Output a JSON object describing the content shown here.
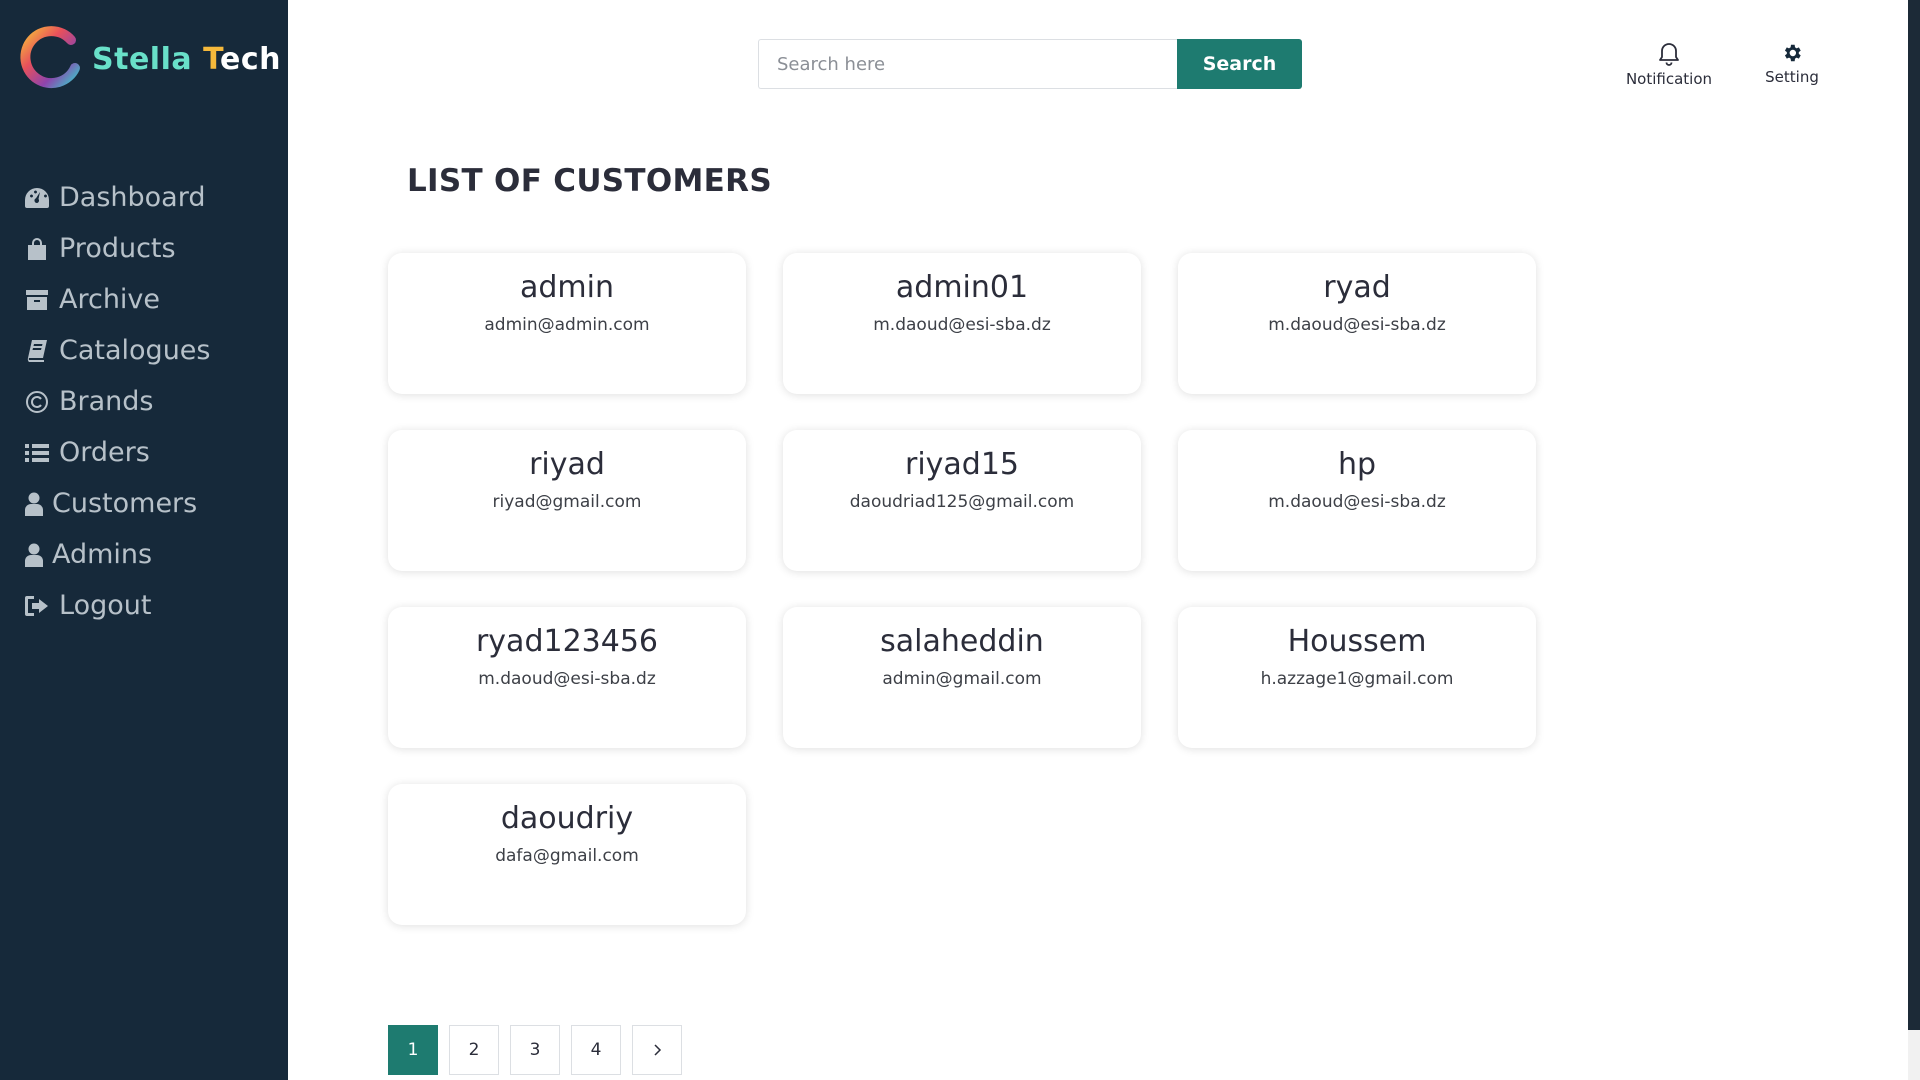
{
  "brand": {
    "name_part1": "Stella ",
    "name_part2": "T",
    "name_part3": "ech",
    "logo_icon": "stella-logo-icon"
  },
  "sidebar": {
    "items": [
      {
        "label": "Dashboard",
        "icon": "dashboard-icon"
      },
      {
        "label": "Products",
        "icon": "shopping-bag-icon"
      },
      {
        "label": "Archive",
        "icon": "archive-icon"
      },
      {
        "label": "Catalogues",
        "icon": "book-icon"
      },
      {
        "label": "Brands",
        "icon": "copyright-icon"
      },
      {
        "label": "Orders",
        "icon": "list-icon"
      },
      {
        "label": "Customers",
        "icon": "user-icon"
      },
      {
        "label": "Admins",
        "icon": "user-icon"
      },
      {
        "label": "Logout",
        "icon": "logout-icon"
      }
    ]
  },
  "search": {
    "placeholder": "Search here",
    "value": "",
    "button_label": "Search"
  },
  "header": {
    "notification_label": "Notification",
    "setting_label": "Setting"
  },
  "page": {
    "title": "LIST OF CUSTOMERS"
  },
  "customers": [
    {
      "name": "admin",
      "email": "admin@admin.com"
    },
    {
      "name": "admin01",
      "email": "m.daoud@esi-sba.dz"
    },
    {
      "name": "ryad",
      "email": "m.daoud@esi-sba.dz"
    },
    {
      "name": "riyad",
      "email": "riyad@gmail.com"
    },
    {
      "name": "riyad15",
      "email": "daoudriad125@gmail.com"
    },
    {
      "name": "hp",
      "email": "m.daoud@esi-sba.dz"
    },
    {
      "name": "ryad123456",
      "email": "m.daoud@esi-sba.dz"
    },
    {
      "name": "salaheddin",
      "email": "admin@gmail.com"
    },
    {
      "name": "Houssem",
      "email": "h.azzage1@gmail.com"
    },
    {
      "name": "daoudriy",
      "email": "dafa@gmail.com"
    }
  ],
  "pagination": {
    "pages": [
      "1",
      "2",
      "3",
      "4"
    ],
    "active": "1",
    "next_symbol": "›"
  },
  "colors": {
    "sidebar_bg": "#16293a",
    "accent": "#1e7b70",
    "nav_text": "#b7c1c9"
  }
}
